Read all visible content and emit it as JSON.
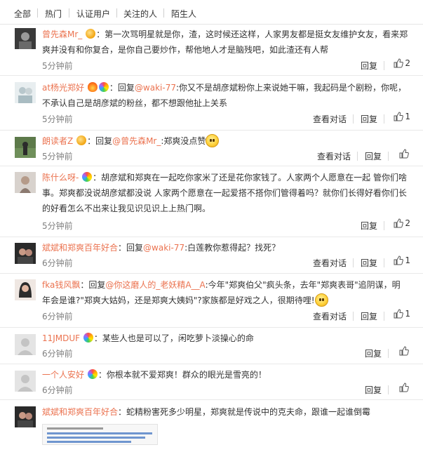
{
  "filters": [
    "全部",
    "热门",
    "认证用户",
    "关注的人",
    "陌生人"
  ],
  "actions": {
    "reply": "回复",
    "view_conversation": "查看对话"
  },
  "colors": {
    "link": "#eb7350",
    "time": "#808080",
    "background": "#f4f4f4"
  },
  "comments": [
    {
      "user": "曾先森Mr_",
      "text_parts": [
        "：第一次骂明星就是你，渣，这时候还这样，人家男友都是挺女友维护女友，看来郑爽并没有和你复合，是你自己要炒作，帮他地人才是脑残吧，如此渣还有人帮"
      ],
      "time": "5分钟前",
      "likes": "2"
    },
    {
      "user": "at杨光郑好",
      "reply_prefix": "：回复",
      "mention": "@waki-77",
      "text": ":你又不是胡彦斌粉你上来说她干嘛，我起码是个剧粉，你呢，不承认自己是胡彦斌的粉丝，都不想跟他扯上关系",
      "time": "5分钟前",
      "likes": "1"
    },
    {
      "user": "朗读者Z",
      "reply_prefix": "：回复",
      "mention": "@曾先森Mr_",
      "text": ":郑爽没点赞",
      "time": "5分钟前",
      "likes": ""
    },
    {
      "user": "陈什么呀-",
      "text": "：胡彦斌和郑爽在一起吃你家米了还是花你家钱了。人家两个人愿意在一起 管你们啥事。郑爽都没说胡彦斌都没说 人家两个愿意在一起爱搭不搭你们管得着吗？就你们长得好看你们长的好看怎么不出来让我见识见识上上热门啊。",
      "time": "5分钟前",
      "likes": "2"
    },
    {
      "user": "斌斌和郑爽百年好合",
      "reply_prefix": "：回复",
      "mention": "@waki-77",
      "text": ":白莲教你惹得起？找死？",
      "time": "6分钟前",
      "likes": "1"
    },
    {
      "user": "fka钱风飘",
      "reply_prefix": "：回复",
      "mention": "@你这磨人的_老妖精A__A",
      "text": ":今年\"郑爽伯父\"疯头条，去年\"郑爽表哥\"追阴谋，明年会是谁?\"郑爽大姑妈，还是郑爽大姨妈\"?家族都是好戏之人，很期待哩!",
      "time": "6分钟前",
      "likes": "1"
    },
    {
      "user": "11JMDUF",
      "text": "：某些人也是可以了，闲吃萝卜淡操心的命",
      "time": "6分钟前",
      "likes": ""
    },
    {
      "user": "一个人安好",
      "text": "：你根本就不爱郑爽！群众的眼光是雪亮的！",
      "time": "6分钟前",
      "likes": ""
    },
    {
      "user": "斌斌和郑爽百年好合",
      "text": "：蛇精粉害死多少明星，郑爽就是传说中的克夫命，跟谁一起谁倒霉",
      "time": "",
      "likes": ""
    }
  ]
}
